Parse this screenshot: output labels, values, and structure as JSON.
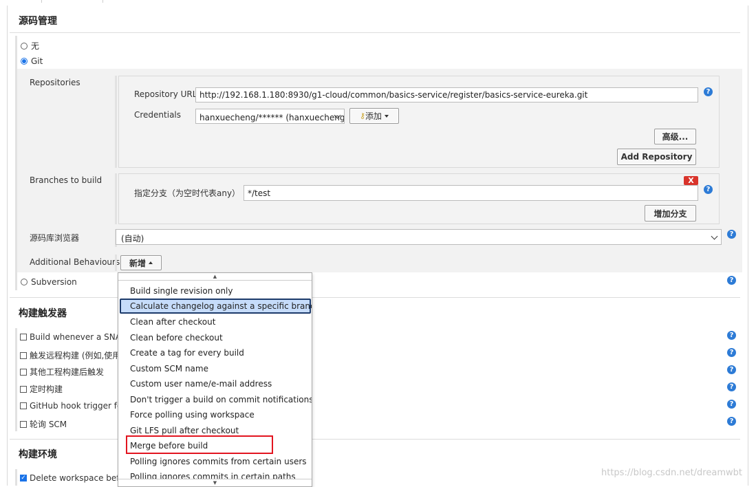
{
  "scm": {
    "title": "源码管理",
    "options": {
      "none": "无",
      "git": "Git",
      "subversion": "Subversion"
    },
    "repositories_label": "Repositories",
    "repo_url_label": "Repository URL",
    "repo_url_value": "http://192.168.1.180:8930/g1-cloud/common/basics-service/register/basics-service-eureka.git",
    "credentials_label": "Credentials",
    "credentials_value": "hanxuecheng/****** (hanxuecheng)",
    "add_label": "添加",
    "advanced_label": "高级...",
    "add_repository_label": "Add Repository",
    "branches_label": "Branches to build",
    "branch_specifier_label": "指定分支（为空时代表any）",
    "branch_value": "*/test",
    "delete_label": "X",
    "add_branch_label": "增加分支",
    "repo_browser_label": "源码库浏览器",
    "repo_browser_value": "(自动)",
    "additional_behaviours_label": "Additional Behaviours",
    "new_label": "新增"
  },
  "menu": {
    "items": [
      "Build single revision only",
      "Calculate changelog against a specific branch",
      "Clean after checkout",
      "Clean before checkout",
      "Create a tag for every build",
      "Custom SCM name",
      "Custom user name/e-mail address",
      "Don't trigger a build on commit notifications",
      "Force polling using workspace",
      "Git LFS pull after checkout",
      "Merge before build",
      "Polling ignores commits from certain users",
      "Polling ignores commits in certain paths"
    ],
    "highlighted_index": 1,
    "marked_index": 10
  },
  "triggers": {
    "title": "构建触发器",
    "items": [
      "Build whenever a SNAPS",
      "触发远程构建 (例如,使用",
      "其他工程构建后触发",
      "定时构建",
      "GitHub hook trigger for (",
      "轮询 SCM"
    ]
  },
  "env": {
    "title": "构建环境",
    "delete_workspace": "Delete workspace before"
  },
  "watermark": "https://blog.csdn.net/dreamwbt",
  "colors": {
    "help": "#2d7bd6",
    "highlight": "#c6dcfa",
    "mark": "#e2141f",
    "delete": "#d9342b"
  }
}
